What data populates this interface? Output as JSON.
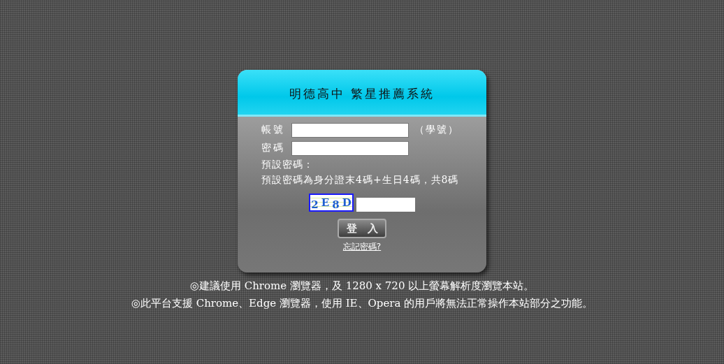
{
  "panel": {
    "title": "明德高中 繁星推薦系統"
  },
  "fields": [
    {
      "label": "帳號",
      "hint": "（學號）"
    },
    {
      "label": "密碼"
    }
  ],
  "note_title": "預設密碼：",
  "note": "預設密碼為身分證末4碼+生日4碼，共8碼",
  "captcha": {
    "text": "2E8D"
  },
  "login_button": "登　入",
  "forgot_link": "忘記密碼?",
  "notices": [
    "◎建議使用 Chrome 瀏覽器，及 1280 x 720 以上螢幕解析度瀏覽本站。",
    "◎此平台支援 Chrome、Edge 瀏覽器，使用 IE、Opera 的用戶將無法正常操作本站部分之功能。"
  ]
}
